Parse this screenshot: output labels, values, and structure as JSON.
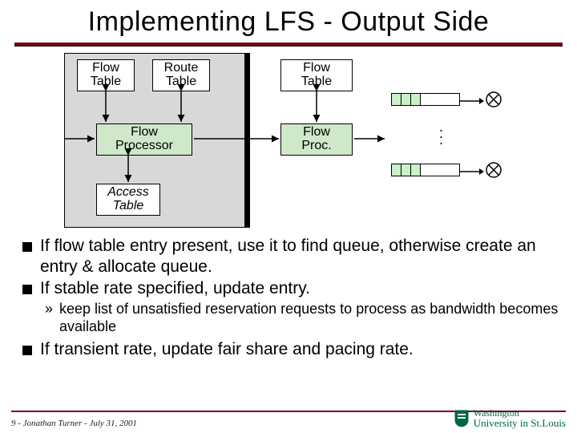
{
  "title": "Implementing LFS - Output Side",
  "diagram": {
    "flow_table": "Flow\nTable",
    "route_table": "Route\nTable",
    "flow_processor": "Flow\nProcessor",
    "access_table": "Access\nTable",
    "flow_table2": "Flow\nTable",
    "flow_proc": "Flow\nProc."
  },
  "bullets": {
    "b1": "If flow table entry present, use it to find queue, otherwise create an entry & allocate queue.",
    "b2": "If stable rate specified, update entry.",
    "b2_sub": "keep list of unsatisfied reservation requests to process as bandwidth becomes available",
    "b3": "If transient rate, update fair share and pacing rate."
  },
  "footer": {
    "note": "9 - Jonathan Turner - July 31, 2001",
    "uni_top": "Washington",
    "uni_bot": "University in St.Louis"
  }
}
